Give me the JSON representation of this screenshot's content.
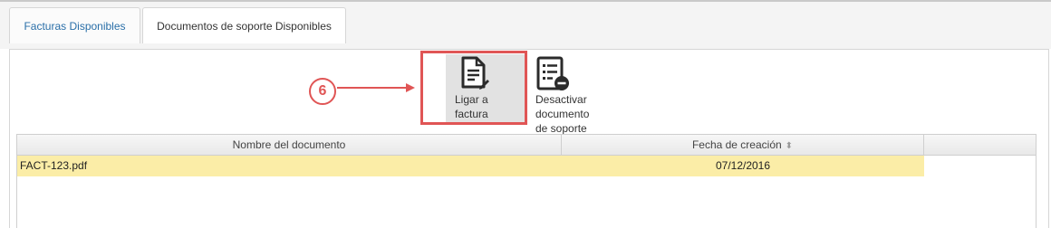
{
  "tabs": [
    {
      "label": "Facturas Disponibles"
    },
    {
      "label": "Documentos de soporte Disponibles"
    }
  ],
  "toolbar": {
    "link_invoice": {
      "label_line1": "Ligar a",
      "label_line2": "factura",
      "icon": "document-edit-icon"
    },
    "deactivate": {
      "label_line1": "Desactivar",
      "label_line2": "documento",
      "label_line3": "de soporte",
      "icon": "list-remove-icon"
    }
  },
  "annotation": {
    "step": "6",
    "color": "#e05555"
  },
  "grid": {
    "columns": [
      {
        "label": "Nombre del documento"
      },
      {
        "label": "Fecha de creación"
      }
    ],
    "rows": [
      {
        "name": "FACT-123.pdf",
        "date": "07/12/2016"
      }
    ]
  },
  "colors": {
    "accent_tab": "#2a6fa8",
    "selected_row": "#fbeda7",
    "highlight": "#e05555"
  }
}
